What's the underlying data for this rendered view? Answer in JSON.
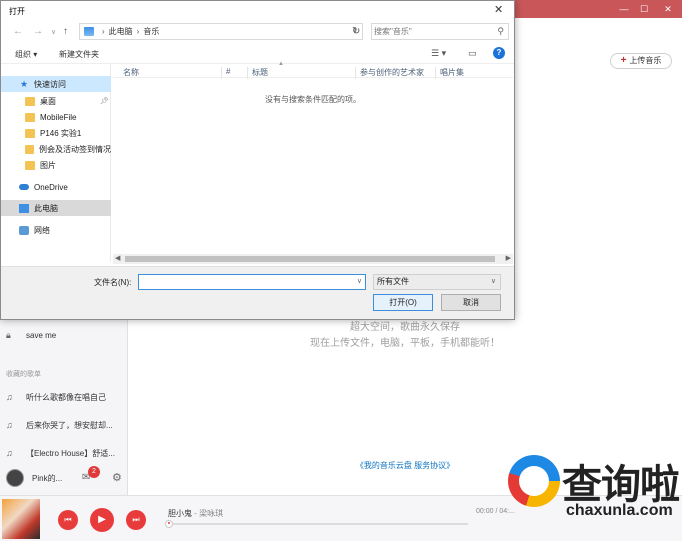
{
  "app": {
    "upload_button": "上传音乐",
    "sidebar": {
      "save_me": "save me",
      "section_title": "收藏的歌单",
      "playlists": [
        "听什么歌都像在唱自己",
        "后来你哭了，想安慰却...",
        "【Electro House】舒适..."
      ],
      "user_name": "Pink的...",
      "mail_badge": "2"
    },
    "empty_line1": "超大空间，歌曲永久保存",
    "empty_line2": "现在上传文件，电脑，平板，手机都能听！",
    "empty_link": "《我的音乐云盘 服务协议》",
    "player": {
      "song_title": "胆小鬼",
      "song_artist": " - 梁咏琪",
      "time": "00:00 / 04:...",
      "progress": 0.0
    },
    "watermark": {
      "text": "查询啦",
      "url": "chaxunla.com"
    }
  },
  "dialog": {
    "title": "打开",
    "address": {
      "root": "此电脑",
      "folder": "音乐"
    },
    "search_placeholder": "搜索\"音乐\"",
    "toolbar": {
      "organize": "组织 ▾",
      "new_folder": "新建文件夹"
    },
    "nav": {
      "quick_access": "快速访问",
      "desktop": "桌面",
      "mobile_file": "MobileFile",
      "p146": "P146 实验1",
      "event": "例会及活动签到情况",
      "pictures": "图片",
      "onedrive": "OneDrive",
      "this_pc": "此电脑",
      "network": "网络"
    },
    "columns": [
      "名称",
      "#",
      "标题",
      "参与创作的艺术家",
      "唱片集"
    ],
    "empty_message": "没有与搜索条件匹配的项。",
    "filename_label": "文件名(N):",
    "filename_value": "",
    "filetype": "所有文件",
    "open_button": "打开(O)",
    "cancel_button": "取消"
  },
  "colors": {
    "app_accent": "#c9575a",
    "player_red": "#e83c3c",
    "dialog_selection": "#cce8ff",
    "link_blue": "#0c73c2"
  }
}
